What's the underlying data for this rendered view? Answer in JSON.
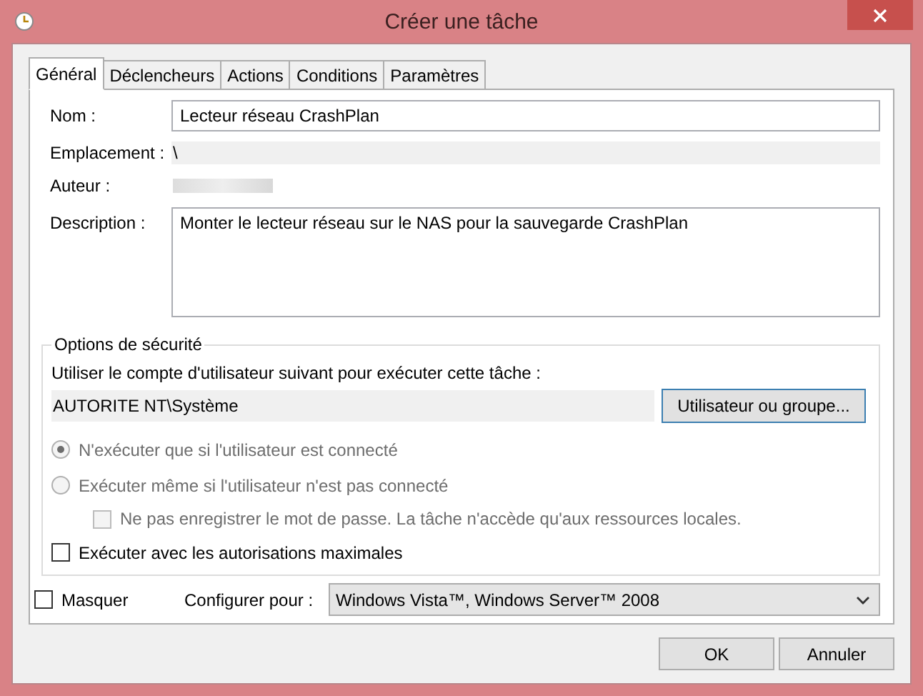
{
  "window": {
    "title": "Créer une tâche"
  },
  "tabs": [
    {
      "label": "Général",
      "selected": true
    },
    {
      "label": "Déclencheurs",
      "selected": false
    },
    {
      "label": "Actions",
      "selected": false
    },
    {
      "label": "Conditions",
      "selected": false
    },
    {
      "label": "Paramètres",
      "selected": false
    }
  ],
  "general": {
    "name": {
      "label": "Nom :",
      "value": "Lecteur réseau CrashPlan"
    },
    "location": {
      "label": "Emplacement :",
      "value": "\\"
    },
    "author": {
      "label": "Auteur :"
    },
    "description": {
      "label": "Description :",
      "value": "Monter le lecteur réseau sur le NAS pour la sauvegarde CrashPlan"
    }
  },
  "security": {
    "legend": "Options de sécurité",
    "prompt": "Utiliser le compte d'utilisateur suivant pour exécuter cette tâche :",
    "account": "AUTORITE NT\\Système",
    "button": "Utilisateur ou groupe...",
    "options": [
      {
        "kind": "radio",
        "label": "N'exécuter que si l'utilisateur est connecté",
        "selected": true,
        "disabled": true
      },
      {
        "kind": "radio",
        "label": "Exécuter même si l'utilisateur n'est pas connecté",
        "selected": false,
        "disabled": true,
        "children": [
          {
            "kind": "checkbox",
            "label": "Ne pas enregistrer le mot de passe. La tâche n'accède qu'aux ressources locales.",
            "checked": false,
            "disabled": true
          }
        ]
      },
      {
        "kind": "checkbox",
        "label": "Exécuter avec les autorisations maximales",
        "checked": false,
        "disabled": false
      }
    ]
  },
  "hidden": {
    "label": "Masquer",
    "checked": false
  },
  "configure": {
    "label": "Configurer pour :",
    "value": "Windows Vista™, Windows Server™ 2008"
  },
  "buttons": [
    "OK",
    "Annuler"
  ]
}
